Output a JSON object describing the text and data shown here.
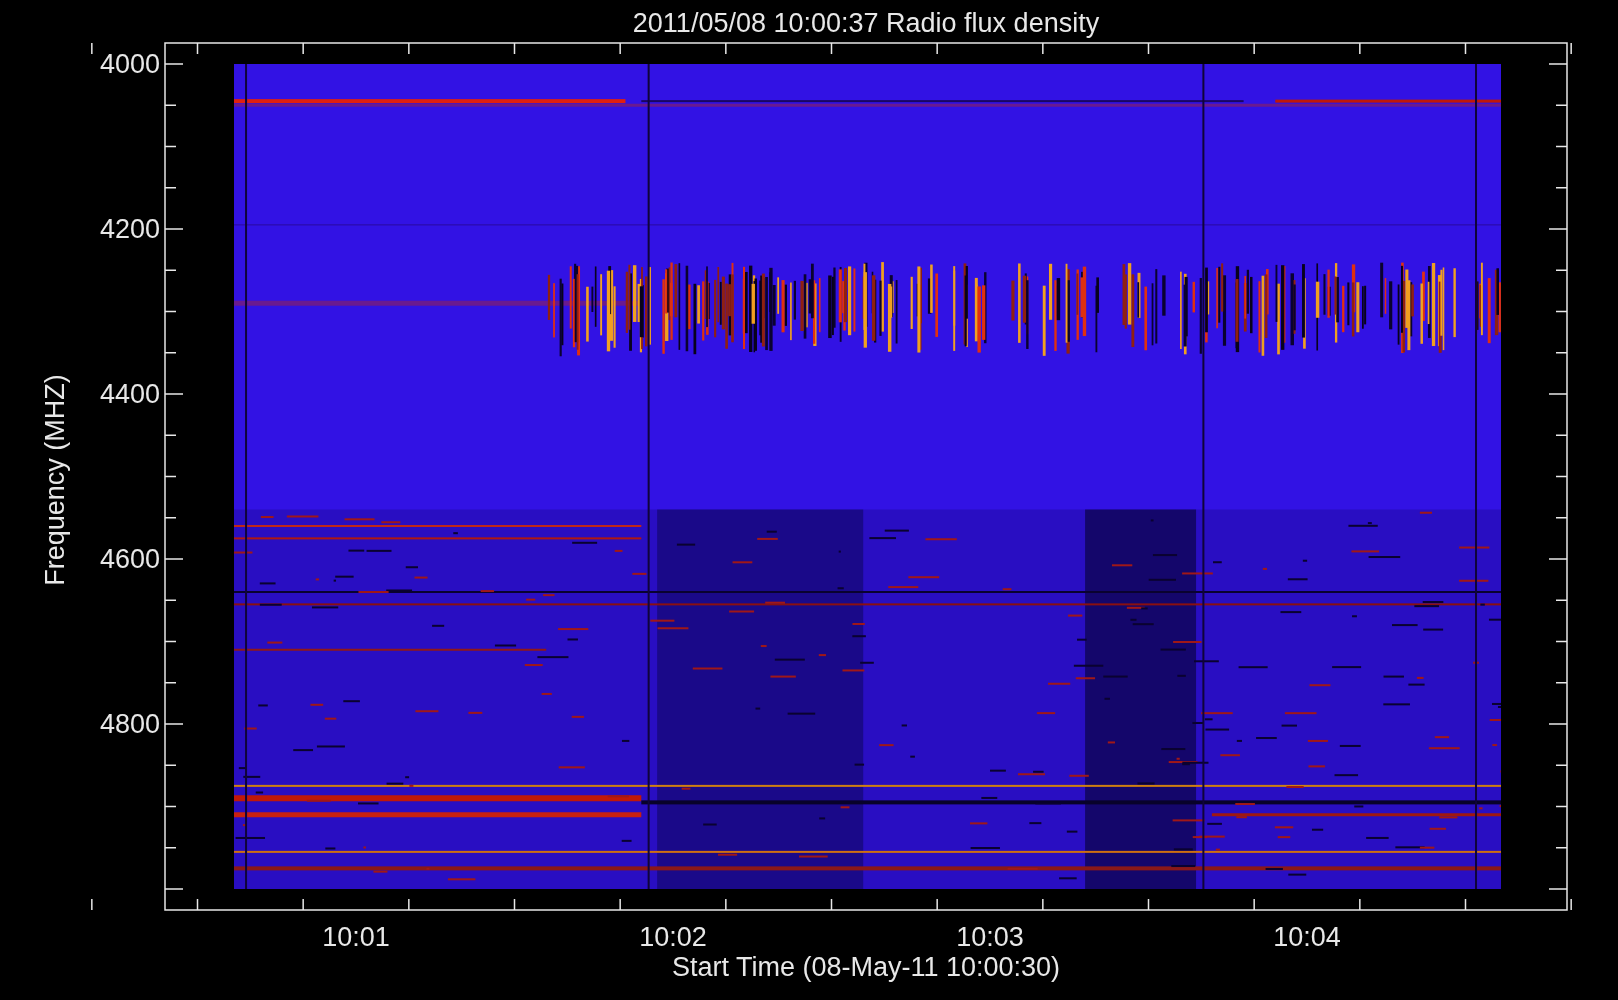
{
  "title": "2011/05/08 10:00:37 Radio flux density",
  "y_axis": {
    "label": "Frequency (MHZ)",
    "ticks": [
      "4000",
      "4200",
      "4400",
      "4600",
      "4800"
    ]
  },
  "x_axis": {
    "label": "Start Time (08-May-11 10:00:30)",
    "ticks": [
      "10:01",
      "10:02",
      "10:03",
      "10:04"
    ]
  }
}
